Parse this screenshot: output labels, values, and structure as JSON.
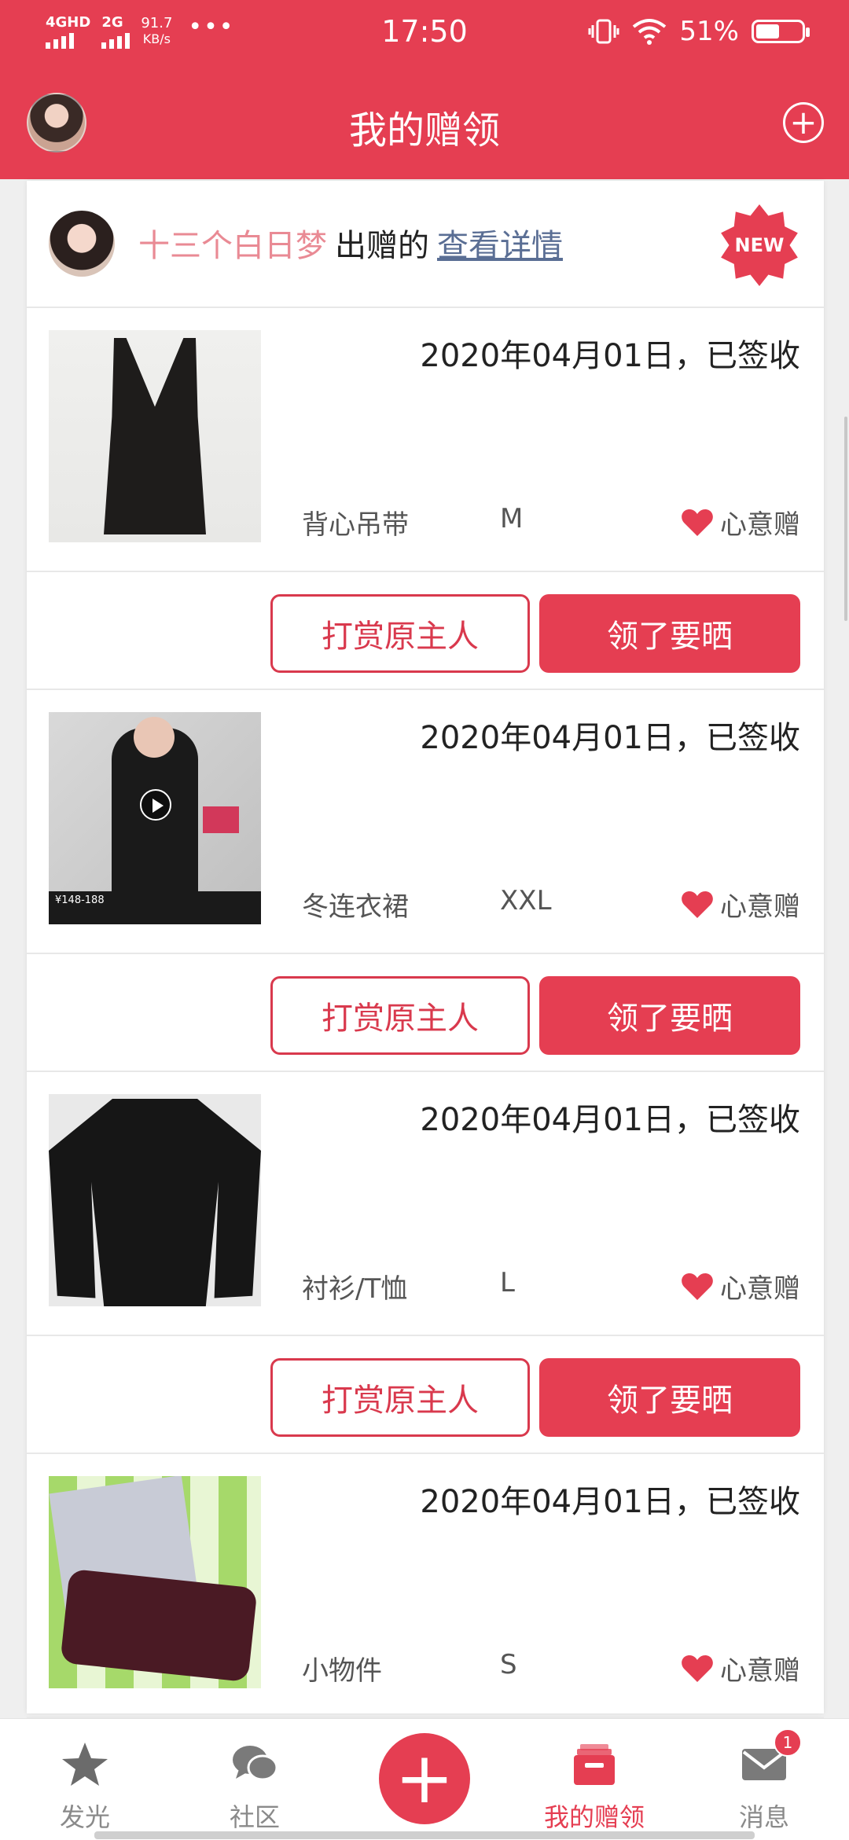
{
  "status_bar": {
    "net1": "4GHD",
    "net2": "2G",
    "speed_value": "91.7",
    "speed_unit": "KB/s",
    "dots": "•••",
    "time": "17:50",
    "battery": "51%",
    "battery_level": 0.51
  },
  "header": {
    "title": "我的赠领"
  },
  "donor": {
    "name": "十三个白日梦",
    "verb": "出赠的",
    "link": "查看详情",
    "badge": "NEW"
  },
  "items": [
    {
      "date": "2020年04月01日，已签收",
      "category": "背心吊带",
      "size": "M",
      "tag": "心意赠"
    },
    {
      "date": "2020年04月01日，已签收",
      "category": "冬连衣裙",
      "size": "XXL",
      "tag": "心意赠",
      "price_text": "¥148-188"
    },
    {
      "date": "2020年04月01日，已签收",
      "category": "衬衫/T恤",
      "size": "L",
      "tag": "心意赠"
    },
    {
      "date": "2020年04月01日，已签收",
      "category": "小物件",
      "size": "S",
      "tag": "心意赠"
    }
  ],
  "actions": {
    "reward": "打赏原主人",
    "show": "领了要晒"
  },
  "bottom_nav": [
    {
      "label": "发光",
      "icon": "star-icon"
    },
    {
      "label": "社区",
      "icon": "chat-icon"
    },
    {
      "label": "",
      "icon": "plus-icon"
    },
    {
      "label": "我的赠领",
      "icon": "gift-box-icon",
      "active": true
    },
    {
      "label": "消息",
      "icon": "mail-icon",
      "badge": "1"
    }
  ],
  "colors": {
    "accent": "#e53e52",
    "donor_name": "#e98a94",
    "link": "#5a6e94"
  }
}
